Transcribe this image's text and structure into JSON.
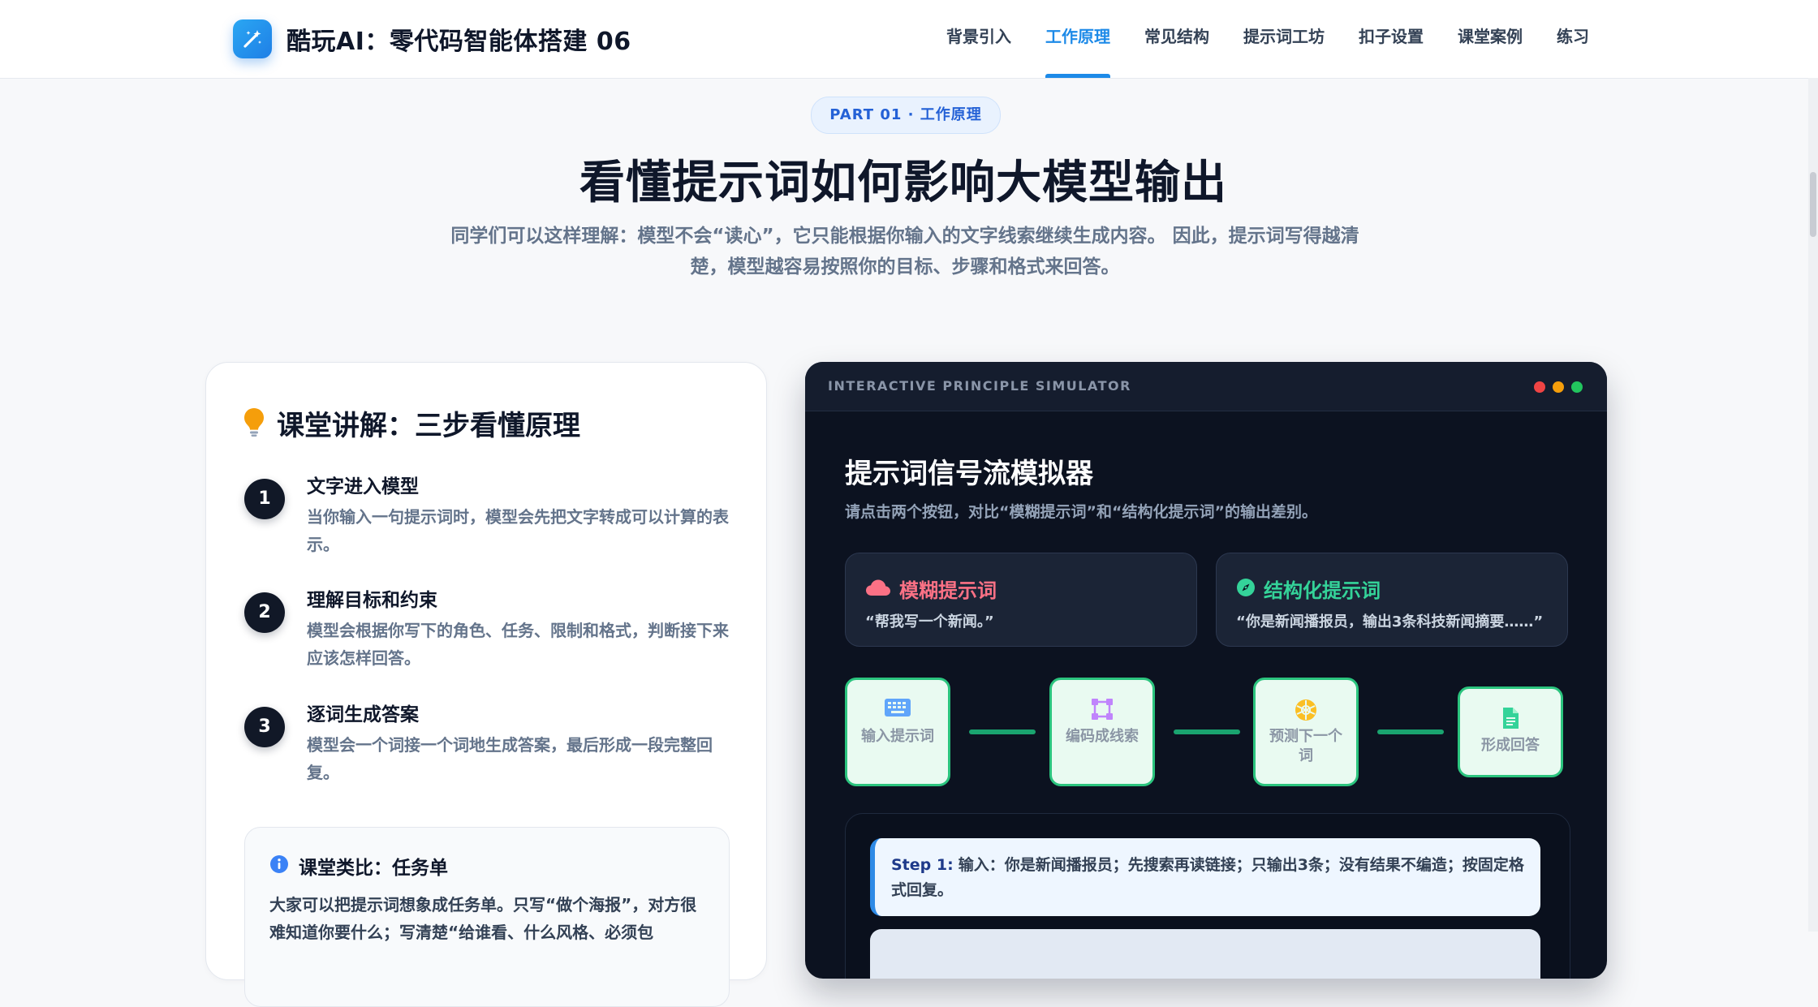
{
  "header": {
    "title": "酷玩AI：零代码智能体搭建 06",
    "nav": [
      {
        "label": "背景引入",
        "active": false
      },
      {
        "label": "工作原理",
        "active": true
      },
      {
        "label": "常见结构",
        "active": false
      },
      {
        "label": "提示词工坊",
        "active": false
      },
      {
        "label": "扣子设置",
        "active": false
      },
      {
        "label": "课堂案例",
        "active": false
      },
      {
        "label": "练习",
        "active": false
      }
    ]
  },
  "hero": {
    "pill": "PART 01 · 工作原理",
    "title": "看懂提示词如何影响大模型输出",
    "subtitle": "同学们可以这样理解：模型不会“读心”，它只能根据你输入的文字线索继续生成内容。 因此，提示词写得越清楚，模型越容易按照你的目标、步骤和格式来回答。"
  },
  "lecture": {
    "title": "课堂讲解：三步看懂原理",
    "steps": [
      {
        "num": "1",
        "title": "文字进入模型",
        "desc": "当你输入一句提示词时，模型会先把文字转成可以计算的表示。"
      },
      {
        "num": "2",
        "title": "理解目标和约束",
        "desc": "模型会根据你写下的角色、任务、限制和格式，判断接下来应该怎样回答。"
      },
      {
        "num": "3",
        "title": "逐词生成答案",
        "desc": "模型会一个词接一个词地生成答案，最后形成一段完整回复。"
      }
    ],
    "analogy": {
      "title": "课堂类比：任务单",
      "text": "大家可以把提示词想象成任务单。只写“做个海报”，对方很难知道你要什么；写清楚“给谁看、什么风格、必须包"
    }
  },
  "simulator": {
    "bar_label": "INTERACTIVE PRINCIPLE SIMULATOR",
    "title": "提示词信号流模拟器",
    "subtitle": "请点击两个按钮，对比“模糊提示词”和“结构化提示词”的输出差别。",
    "modes": [
      {
        "name": "模糊提示词",
        "example": "“帮我写一个新闻。”",
        "color": "#fb7185"
      },
      {
        "name": "结构化提示词",
        "example": "“你是新闻播报员，输出3条科技新闻摘要……”",
        "color": "#34d399"
      }
    ],
    "flow": [
      {
        "label": "输入提示词",
        "icon": "keyboard-icon"
      },
      {
        "label": "编码成线索",
        "icon": "vector-square-icon"
      },
      {
        "label": "预测下一个词",
        "icon": "brain-icon"
      },
      {
        "label": "形成回答",
        "icon": "document-icon"
      }
    ],
    "step_label": "Step 1:",
    "step_text": "输入：你是新闻播报员；先搜索再读链接；只输出3条；没有结果不编造；按固定格式回复。"
  },
  "colors": {
    "accent": "#1d8ae8",
    "sim_bg": "#0c1220",
    "flow_green": "#2bc47e",
    "dot_red": "#ef4444",
    "dot_yellow": "#f59e0b",
    "dot_green": "#22c55e"
  }
}
